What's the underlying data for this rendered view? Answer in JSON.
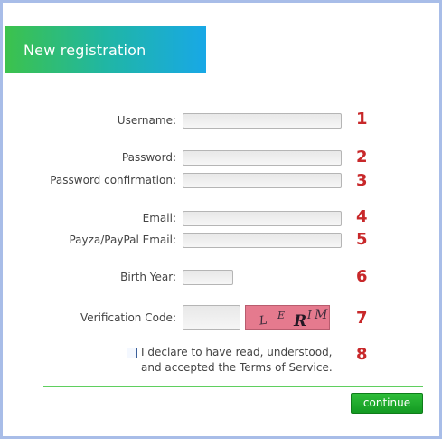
{
  "header": {
    "title": "New registration"
  },
  "form": {
    "username_label": "Username:",
    "password_label": "Password:",
    "password_confirm_label": "Password confirmation:",
    "email_label": "Email:",
    "payza_email_label": "Payza/PayPal Email:",
    "birth_year_label": "Birth Year:",
    "verification_label": "Verification Code:",
    "captcha_glyphs": [
      "L",
      "E",
      "R",
      "I",
      "M"
    ],
    "terms_line1": "I declare to have read, understood,",
    "terms_line2": "and accepted the Terms of Service.",
    "continue_label": "continue"
  },
  "step_numbers": [
    "1",
    "2",
    "3",
    "4",
    "5",
    "6",
    "7",
    "8"
  ],
  "colors": {
    "header_gradient": [
      "#3cc24c",
      "#18a8e6"
    ],
    "step_number": "#c8282a",
    "divider": "#5fcf5f",
    "button": "#139a22",
    "frame_border": "#a8bde8",
    "captcha_bg": "#e57a8e"
  }
}
